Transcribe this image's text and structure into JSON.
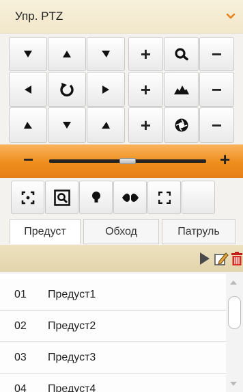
{
  "header": {
    "title": "Упр. PTZ",
    "icon": "chevron-down-icon",
    "accent": "#e8831c"
  },
  "ptz_grid": {
    "rows": [
      [
        {
          "name": "pan-up-left-button",
          "icon": "arrow-down-right"
        },
        {
          "name": "pan-up-button",
          "icon": "arrow-up"
        },
        {
          "name": "pan-up-right-button",
          "icon": "arrow-down-left"
        },
        {
          "name": "zoom-in-button",
          "label": "+"
        },
        {
          "name": "zoom-icon",
          "icon": "magnifier"
        },
        {
          "name": "zoom-out-button",
          "label": "−"
        }
      ],
      [
        {
          "name": "pan-left-button",
          "icon": "arrow-left"
        },
        {
          "name": "auto-rotate-button",
          "icon": "rotate"
        },
        {
          "name": "pan-right-button",
          "icon": "arrow-right"
        },
        {
          "name": "focus-near-button",
          "label": "+"
        },
        {
          "name": "focus-icon",
          "icon": "mountain"
        },
        {
          "name": "focus-far-button",
          "label": "−"
        }
      ],
      [
        {
          "name": "pan-down-left-button",
          "icon": "arrow-up-right"
        },
        {
          "name": "pan-down-button",
          "icon": "arrow-down"
        },
        {
          "name": "pan-down-right-button",
          "icon": "arrow-up-left"
        },
        {
          "name": "iris-open-button",
          "label": "+"
        },
        {
          "name": "iris-icon",
          "icon": "aperture"
        },
        {
          "name": "iris-close-button",
          "label": "−"
        }
      ]
    ]
  },
  "speed_slider": {
    "minus": "−",
    "plus": "+",
    "value_fraction": 0.5
  },
  "tools": [
    "center-frame-icon",
    "zoom-area-icon",
    "light-icon",
    "wiper-icon",
    "fullscreen-icon",
    "empty-tool"
  ],
  "tabs": [
    {
      "label": "Предуст",
      "active": true
    },
    {
      "label": "Обход",
      "active": false
    },
    {
      "label": "Патруль",
      "active": false
    }
  ],
  "preset_toolbar": [
    "play-icon",
    "edit-icon",
    "delete-icon"
  ],
  "presets": [
    {
      "num": "01",
      "name": "Предуст1"
    },
    {
      "num": "02",
      "name": "Предуст2"
    },
    {
      "num": "03",
      "name": "Предуст3"
    },
    {
      "num": "04",
      "name": "Предуст4"
    }
  ]
}
